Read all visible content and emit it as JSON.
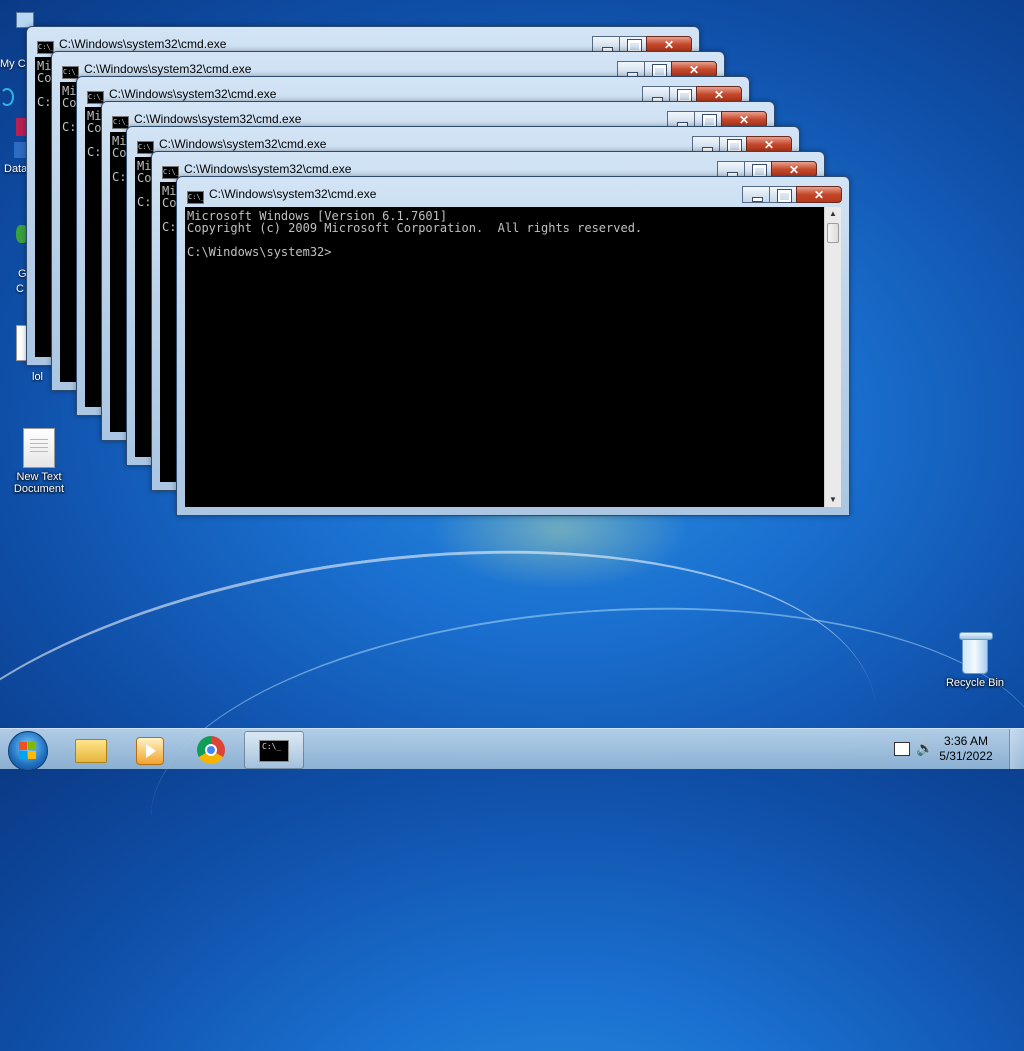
{
  "windows": {
    "title": "C:\\Windows\\system32\\cmd.exe",
    "icon_label": "C:\\_",
    "line1": "Microsoft Windows [Version 6.1.7601]",
    "line2": "Copyright (c) 2009 Microsoft Corporation.  All rights reserved.",
    "prompt": "C:\\Windows\\system32>"
  },
  "desktop": {
    "icons": [
      {
        "name": "new-text-document",
        "label": "New Text Document"
      },
      {
        "name": "recycle-bin",
        "label": "Recycle Bin"
      }
    ],
    "partial_labels": {
      "my_computer": "My C",
      "data": "Data",
      "g1": "G",
      "g2": "C",
      "lol": "lol"
    }
  },
  "taskbar": {
    "time": "3:36 AM",
    "date": "5/31/2022",
    "cmd_icon_label": "C:\\_",
    "icons": [
      "start-orb-icon",
      "folder-icon",
      "media-player-icon",
      "chrome-icon",
      "cmd-icon",
      "network-icon",
      "volume-icon"
    ]
  }
}
